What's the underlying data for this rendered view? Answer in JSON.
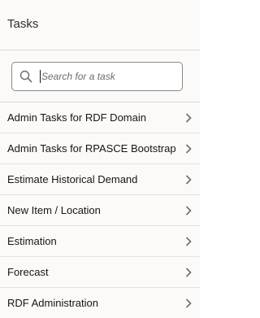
{
  "header": {
    "title": "Tasks"
  },
  "search": {
    "placeholder": "Search for a task",
    "value": "",
    "icon": "search-icon"
  },
  "tasks": [
    {
      "label": "Admin Tasks for RDF Domain",
      "icon": "chevron-right-icon"
    },
    {
      "label": "Admin Tasks for RPASCE Bootstrap",
      "icon": "chevron-right-icon"
    },
    {
      "label": "Estimate Historical Demand",
      "icon": "chevron-right-icon"
    },
    {
      "label": "New Item / Location",
      "icon": "chevron-right-icon"
    },
    {
      "label": "Estimation",
      "icon": "chevron-right-icon"
    },
    {
      "label": "Forecast",
      "icon": "chevron-right-icon"
    },
    {
      "label": "RDF Administration",
      "icon": "chevron-right-icon"
    }
  ],
  "colors": {
    "background": "#fbfaf9",
    "text": "#161513",
    "divider": "#dcdad6",
    "chevron": "#6f6c69"
  }
}
